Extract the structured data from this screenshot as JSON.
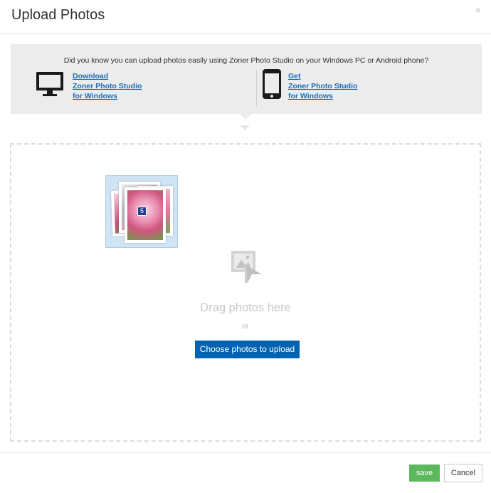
{
  "dialog": {
    "title": "Upload Photos",
    "close_glyph": "×"
  },
  "promo": {
    "message": "Did you know you can upload photos easily using Zoner Photo Studio on your Windows PC or Android phone?",
    "left": {
      "icon": "monitor-icon",
      "line1": "Download",
      "line2": "Zoner Photo Studio",
      "line3": "for Windows"
    },
    "right": {
      "icon": "smartphone-icon",
      "line1": "Get",
      "line2": "Zoner Photo Studio",
      "line3": "for Windows"
    }
  },
  "dropzone": {
    "drag_count": "5",
    "icon": "image-upload-icon",
    "drag_text": "Drag photos here",
    "or_text": "or",
    "choose_label": "Choose photos to upload"
  },
  "footer": {
    "save_label": "save",
    "cancel_label": "Cancel"
  },
  "colors": {
    "accent": "#0063b1",
    "save": "#5cb85c",
    "link": "#1a6dbb"
  }
}
